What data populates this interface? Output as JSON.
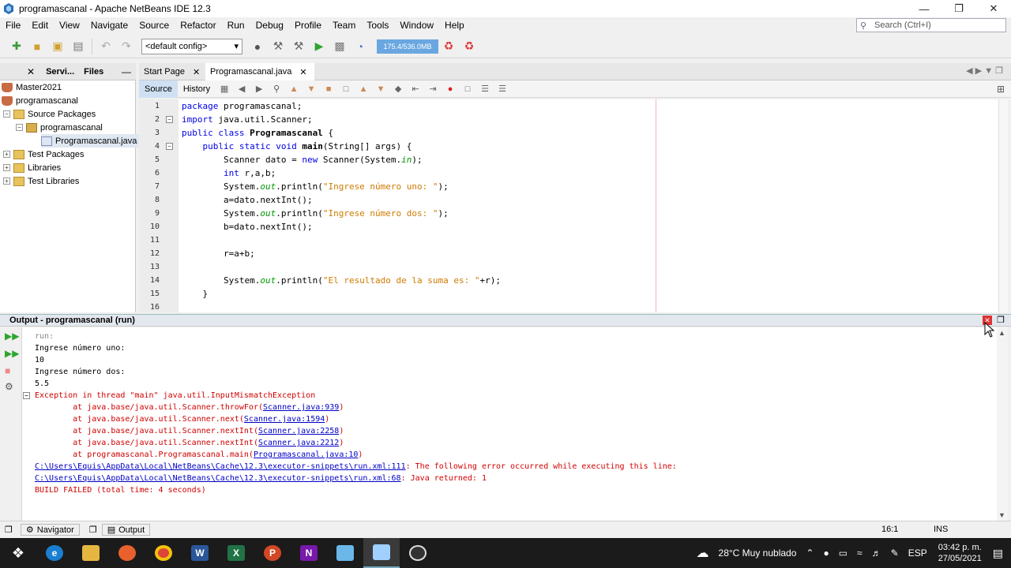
{
  "window": {
    "title": "programascanal - Apache NetBeans IDE 12.3"
  },
  "menu": [
    "File",
    "Edit",
    "View",
    "Navigate",
    "Source",
    "Refactor",
    "Run",
    "Debug",
    "Profile",
    "Team",
    "Tools",
    "Window",
    "Help"
  ],
  "search": {
    "placeholder": "Search (Ctrl+I)"
  },
  "toolbar": {
    "config": "<default config>",
    "memory": "175.4/536.0MB"
  },
  "project_tabs": [
    "Servi...",
    "Files"
  ],
  "tree": [
    {
      "label": "Master2021"
    },
    {
      "label": "programascanal"
    },
    {
      "label": "Source Packages"
    },
    {
      "label": "programascanal"
    },
    {
      "label": "Programascanal.java"
    },
    {
      "label": "Test Packages"
    },
    {
      "label": "Libraries"
    },
    {
      "label": "Test Libraries"
    }
  ],
  "editor_tabs": [
    "Start Page",
    "Programascanal.java"
  ],
  "editor_modes": [
    "Source",
    "History"
  ],
  "code": {
    "line_numbers": [
      "1",
      "2",
      "3",
      "4",
      "5",
      "6",
      "7",
      "8",
      "9",
      "10",
      "11",
      "12",
      "13",
      "14",
      "15",
      "16"
    ],
    "l1": {
      "a": "package ",
      "b": "programascanal;"
    },
    "l2": {
      "a": "import ",
      "b": "java.util.Scanner;"
    },
    "l3": {
      "a": "public class ",
      "b": "Programascanal",
      "c": " {"
    },
    "l4": {
      "a": "    public static void ",
      "b": "main",
      "c": "(String[] args) {"
    },
    "l5": {
      "a": "        Scanner dato = ",
      "b": "new",
      "c": " Scanner(System.",
      "d": "in",
      "e": ");"
    },
    "l6": {
      "a": "        int ",
      "b": "r,a,b;"
    },
    "l7": {
      "a": "        System.",
      "b": "out",
      "c": ".println(",
      "d": "\"Ingrese número uno: \"",
      "e": ");"
    },
    "l8": {
      "a": "        a=dato.nextInt();"
    },
    "l9": {
      "a": "        System.",
      "b": "out",
      "c": ".println(",
      "d": "\"Ingrese número dos: \"",
      "e": ");"
    },
    "l10": {
      "a": "        b=dato.nextInt();"
    },
    "l12": {
      "a": "        r=a+b;"
    },
    "l14": {
      "a": "        System.",
      "b": "out",
      "c": ".println(",
      "d": "\"El resultado de la suma es: \"",
      "e": "+r);"
    },
    "l15": {
      "a": "    }"
    }
  },
  "output": {
    "title": "Output - programascanal (run)",
    "lines": {
      "run": "run:",
      "l1": "Ingrese número uno:",
      "l2": "10",
      "l3": "Ingrese número dos:",
      "l4": "5.5",
      "exc": "Exception in thread \"main\" java.util.InputMismatchException",
      "at1a": "        at java.base/java.util.Scanner.throwFor(",
      "at1b": "Scanner.java:939",
      "at1c": ")",
      "at2a": "        at java.base/java.util.Scanner.next(",
      "at2b": "Scanner.java:1594",
      "at2c": ")",
      "at3a": "        at java.base/java.util.Scanner.nextInt(",
      "at3b": "Scanner.java:2258",
      "at3c": ")",
      "at4a": "        at java.base/java.util.Scanner.nextInt(",
      "at4b": "Scanner.java:2212",
      "at4c": ")",
      "at5a": "        at programascanal.Programascanal.main(",
      "at5b": "Programascanal.java:10",
      "at5c": ")",
      "p1a": "C:\\Users\\Equis\\AppData\\Local\\NetBeans\\Cache\\12.3\\executor-snippets\\run.xml:111",
      "p1b": ": The following error occurred while executing this line:",
      "p2a": "C:\\Users\\Equis\\AppData\\Local\\NetBeans\\Cache\\12.3\\executor-snippets\\run.xml:68",
      "p2b": ": Java returned: 1",
      "fail": "BUILD FAILED (total time: 4 seconds)"
    }
  },
  "status": {
    "navigator": "Navigator",
    "output": "Output",
    "position": "16:1",
    "mode": "INS"
  },
  "taskbar": {
    "weather": "28°C  Muy nublado",
    "lang": "ESP",
    "time": "03:42 p. m.",
    "date": "27/05/2021"
  },
  "colors": {
    "accent": "#6aa7e0",
    "error": "#d00000",
    "keyword": "#0000e6",
    "string": "#ce7b00"
  }
}
